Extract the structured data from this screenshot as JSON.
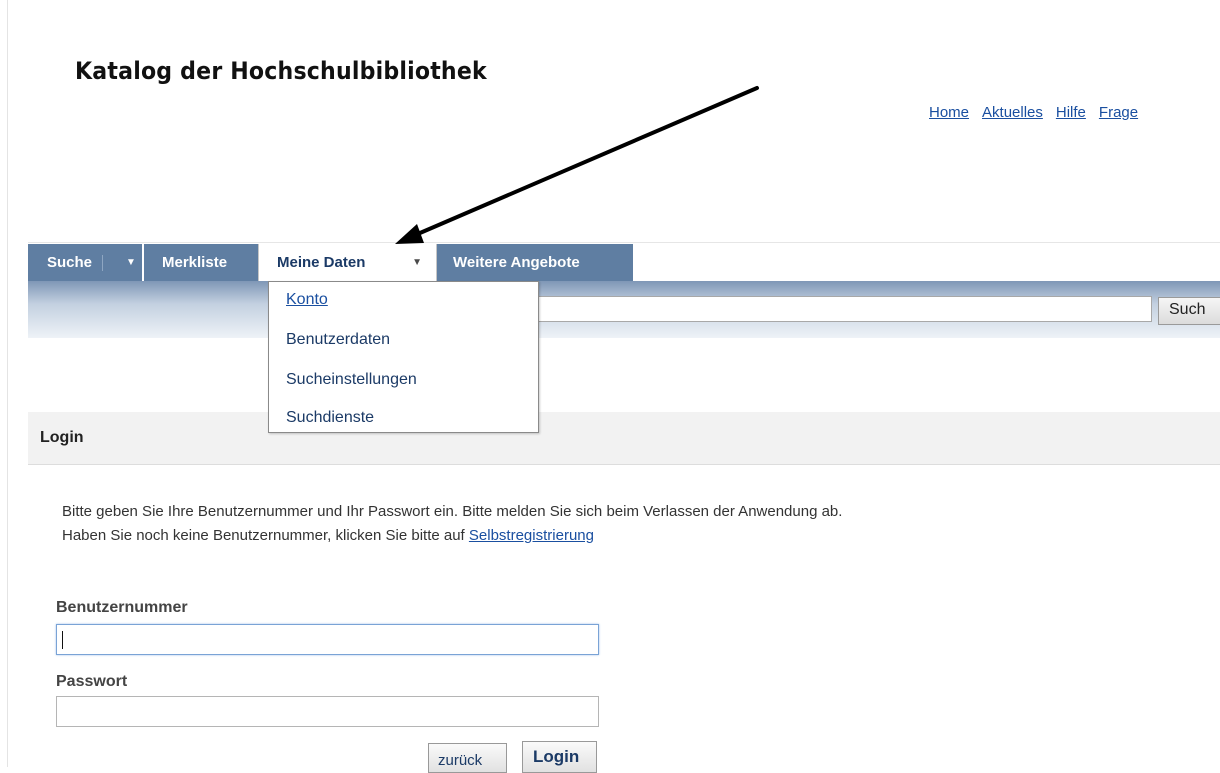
{
  "header": {
    "site_title": "Katalog der Hochschulbibliothek",
    "top_links": [
      "Home",
      "Aktuelles",
      "Hilfe",
      "Frage"
    ]
  },
  "nav": {
    "tabs": {
      "suche": "Suche",
      "merkliste": "Merkliste",
      "meine_daten": "Meine Daten",
      "weitere": "Weitere Angebote"
    },
    "dropdown_items": [
      "Konto",
      "Benutzerdaten",
      "Sucheinstellungen",
      "Suchdienste"
    ]
  },
  "search": {
    "input_value": "",
    "button_label": "Such"
  },
  "login": {
    "heading": "Login",
    "info_line1": "Bitte geben Sie Ihre Benutzernummer und Ihr Passwort ein. Bitte melden Sie sich beim Verlassen der Anwendung ab.",
    "info_line2_prefix": "Haben Sie noch keine Benutzernummer, klicken Sie bitte auf ",
    "info_line2_link": "Selbstregistrierung",
    "user_label": "Benutzernummer",
    "user_value": "",
    "password_label": "Passwort",
    "password_value": "",
    "back_button": "zurück",
    "login_button": "Login"
  },
  "colors": {
    "tab_background": "#5f7ea2",
    "link": "#1a4fa0",
    "annotation_arrow": "#000000"
  }
}
